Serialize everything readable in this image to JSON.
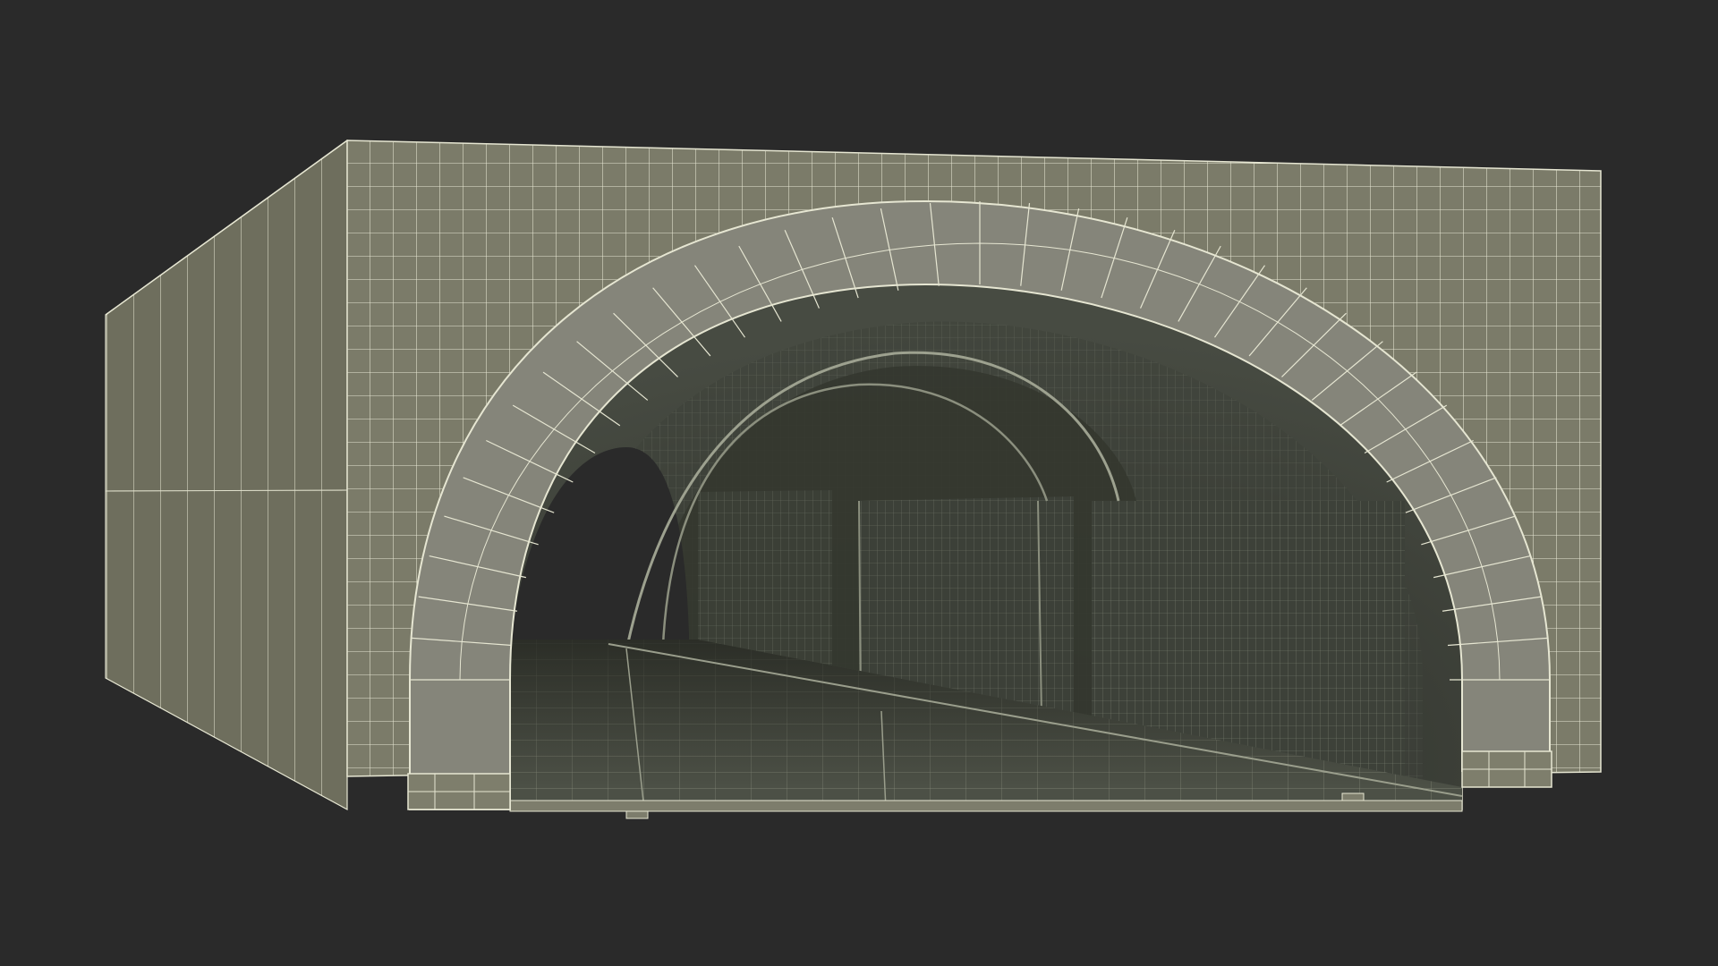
{
  "colors": {
    "background": "#2a2a2a",
    "front_wall": "#7b7b69",
    "side_wall": "#6c6c5b",
    "arch_ring": "#85857a",
    "tunnel_dark": "#2b2d28",
    "tunnel_mid": "#3f433b",
    "floor": "#4e5247",
    "wire": "#e8e8d4"
  },
  "scene": {
    "subject": "stone-arch-tunnel-wireframe-render"
  }
}
